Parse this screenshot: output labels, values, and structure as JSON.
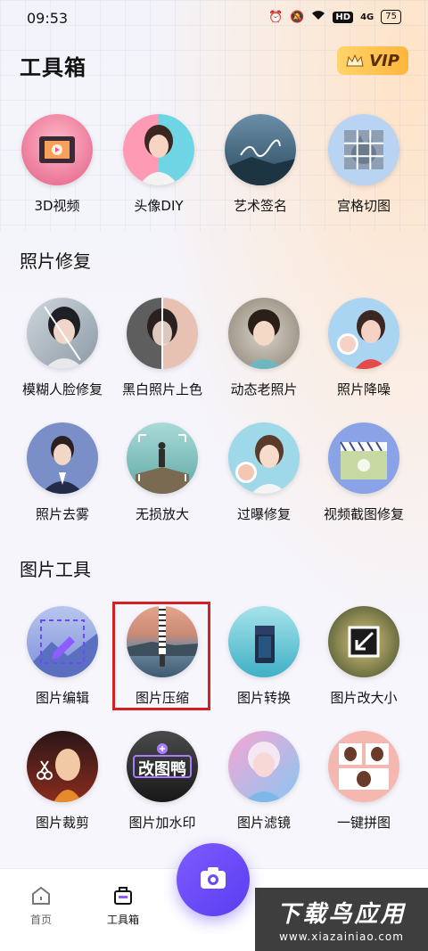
{
  "status_bar": {
    "time": "09:53",
    "network": "4G",
    "battery": "75",
    "hd": "HD"
  },
  "header": {
    "title": "工具箱",
    "vip_label": "VIP"
  },
  "top_tools": [
    {
      "label": "3D视频",
      "icon": "film-3d-icon"
    },
    {
      "label": "头像DIY",
      "icon": "avatar-portrait-icon"
    },
    {
      "label": "艺术签名",
      "icon": "signature-art-icon"
    },
    {
      "label": "宫格切图",
      "icon": "grid-cut-icon"
    }
  ],
  "sections": [
    {
      "title": "照片修复"
    },
    {
      "title": "图片工具"
    }
  ],
  "repair_tools": [
    {
      "label": "模糊人脸修复"
    },
    {
      "label": "黑白照片上色"
    },
    {
      "label": "动态老照片"
    },
    {
      "label": "照片降噪"
    },
    {
      "label": "照片去雾"
    },
    {
      "label": "无损放大"
    },
    {
      "label": "过曝修复"
    },
    {
      "label": "视频截图修复"
    }
  ],
  "image_tools": [
    {
      "label": "图片编辑"
    },
    {
      "label": "图片压缩"
    },
    {
      "label": "图片转换"
    },
    {
      "label": "图片改大小"
    },
    {
      "label": "图片裁剪"
    },
    {
      "label": "图片加水印",
      "overlay_text": "改图鸭"
    },
    {
      "label": "图片滤镜"
    },
    {
      "label": "一键拼图"
    }
  ],
  "bottom_nav": [
    {
      "label": "首页",
      "icon": "home-icon"
    },
    {
      "label": "工具箱",
      "icon": "toolbox-icon"
    }
  ],
  "watermark": {
    "title": "下载鸟应用",
    "url": "www.xiazainiao.com"
  },
  "colors": {
    "accent": "#6a4cf5",
    "highlight": "#d42020",
    "vip": "#ffc24e"
  }
}
